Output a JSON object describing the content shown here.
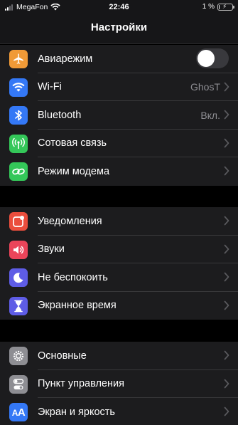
{
  "status": {
    "carrier": "MegaFon",
    "time": "22:46",
    "battery_text": "1 %",
    "battery_level": 0.01
  },
  "nav": {
    "title": "Настройки"
  },
  "groups": [
    {
      "items": [
        {
          "label": "Авиарежим",
          "icon": "airplane-icon",
          "color": "#f09a37",
          "toggle": true,
          "toggle_on": false
        },
        {
          "label": "Wi-Fi",
          "icon": "wifi-icon",
          "color": "#3478f6",
          "value": "GhosT"
        },
        {
          "label": "Bluetooth",
          "icon": "bluetooth-icon",
          "color": "#3478f6",
          "value": "Вкл."
        },
        {
          "label": "Сотовая связь",
          "icon": "antenna-icon",
          "color": "#34c759"
        },
        {
          "label": "Режим модема",
          "icon": "hotspot-icon",
          "color": "#34c759"
        }
      ]
    },
    {
      "items": [
        {
          "label": "Уведомления",
          "icon": "notifications-icon",
          "color": "#eb4e3d"
        },
        {
          "label": "Звуки",
          "icon": "speaker-icon",
          "color": "#eb445a"
        },
        {
          "label": "Не беспокоить",
          "icon": "moon-icon",
          "color": "#5e5ce6"
        },
        {
          "label": "Экранное время",
          "icon": "hourglass-icon",
          "color": "#5e5ce6"
        }
      ]
    },
    {
      "items": [
        {
          "label": "Основные",
          "icon": "gear-icon",
          "color": "#8e8e93"
        },
        {
          "label": "Пункт управления",
          "icon": "switches-icon",
          "color": "#8e8e93"
        },
        {
          "label": "Экран и яркость",
          "icon": "text-size-icon",
          "color": "#3478f6"
        }
      ]
    }
  ]
}
